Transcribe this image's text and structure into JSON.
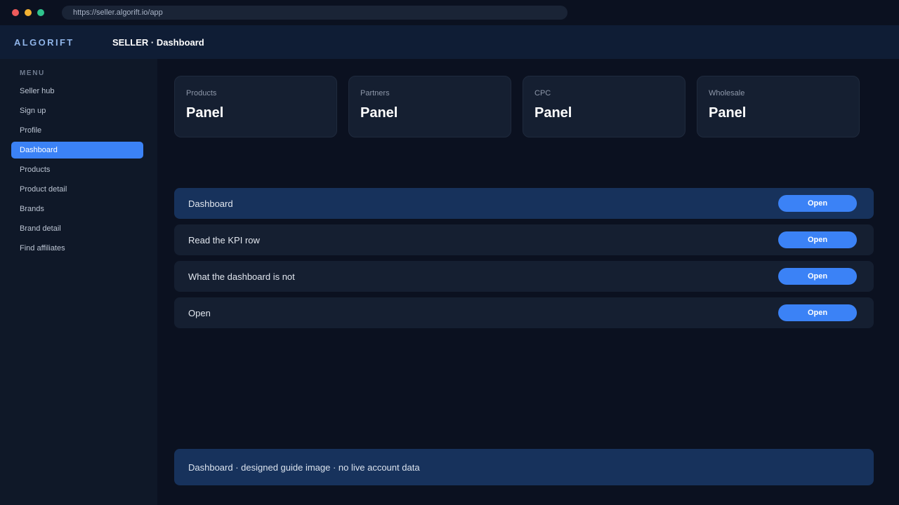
{
  "browser": {
    "url": "https://seller.algorift.io/app"
  },
  "header": {
    "brand": "ALGORIFT",
    "title": "SELLER · Dashboard"
  },
  "sidebar": {
    "heading": "MENU",
    "active_item": "Dashboard",
    "items": [
      {
        "label": "Seller hub"
      },
      {
        "label": "Sign up"
      },
      {
        "label": "Profile"
      },
      {
        "label": "Dashboard"
      },
      {
        "label": "Products"
      },
      {
        "label": "Product detail"
      },
      {
        "label": "Brands"
      },
      {
        "label": "Brand detail"
      },
      {
        "label": "Find affiliates"
      }
    ]
  },
  "kpis": [
    {
      "label": "Products",
      "value": "Panel"
    },
    {
      "label": "Partners",
      "value": "Panel"
    },
    {
      "label": "CPC",
      "value": "Panel"
    },
    {
      "label": "Wholesale",
      "value": "Panel"
    }
  ],
  "rows": [
    {
      "label": "Dashboard",
      "button": "Open"
    },
    {
      "label": "Read the KPI row",
      "button": "Open"
    },
    {
      "label": "What the dashboard is not",
      "button": "Open"
    },
    {
      "label": "Open",
      "button": "Open"
    }
  ],
  "footer": {
    "note": "Dashboard · designed guide image · no live account data"
  },
  "colors": {
    "accent": "#3b82f6",
    "background": "#0b1120",
    "highlight_row": "#17325c"
  }
}
